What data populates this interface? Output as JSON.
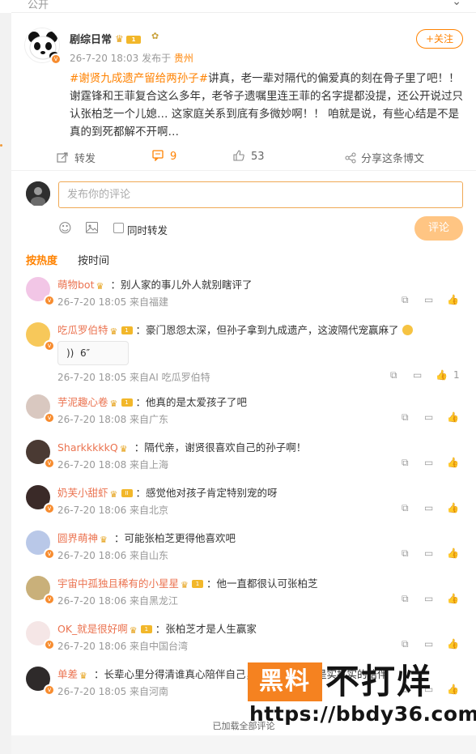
{
  "topbar": {
    "visibility_label": "公开"
  },
  "post": {
    "author": "剧综日常",
    "level": "1",
    "date": "26-7-20 18:03",
    "location_prefix": "发布于",
    "location": "贵州",
    "follow_label": "+关注",
    "hashtag": "#谢贤九成遗产留给两孙子#",
    "body": "讲真，老一辈对隔代的偏爱真的刻在骨子里了吧！！谢霆锋和王菲复合这么多年，老爷子遗嘱里连王菲的名字提都没提，还公开说过只认张柏芝一个儿媳… 这家庭关系到底有多微妙啊！！ 咱就是说，有些心结是不是真的到死都解不开啊…",
    "actions": {
      "repost_label": "转发",
      "comment_count": "9",
      "like_count": "53",
      "share_label": "分享这条博文"
    }
  },
  "composer": {
    "placeholder": "发布你的评论",
    "repost_checkbox_label": "同时转发",
    "submit_label": "评论"
  },
  "sort": {
    "hot_label": "按热度",
    "time_label": "按时间"
  },
  "comments": [
    {
      "name": "萌物bot",
      "level": "",
      "text": "别人家的事儿外人就别瞎评了",
      "time": "26-7-20 18:05 来自福建",
      "likes": "",
      "avatar_color": "#f2c6e6"
    },
    {
      "name": "吃瓜罗伯特",
      "level": "1",
      "text": "豪门恩怨太深，但孙子拿到九成遗产，这波隔代宠赢麻了",
      "time": "26-7-20 18:05 来自AI 吃瓜罗伯特",
      "likes": "1",
      "voice": "6″",
      "avatar_color": "#f7c85a"
    },
    {
      "name": "芋泥趣心卷",
      "level": "1",
      "text": "他真的是太爱孩子了吧",
      "time": "26-7-20 18:08 来自广东",
      "likes": "",
      "avatar_color": "#d9c8c0"
    },
    {
      "name": "SharkkkkkQ",
      "level": "",
      "text": "隔代亲，谢贤很喜欢自己的孙子啊！",
      "time": "26-7-20 18:08 来自上海",
      "likes": "",
      "avatar_color": "#4a3a33"
    },
    {
      "name": "奶芙小甜虾",
      "level": "II",
      "text": "感觉他对孩子肯定特别宠的呀",
      "time": "26-7-20 18:06 来自北京",
      "likes": "",
      "avatar_color": "#3a2a28"
    },
    {
      "name": "圆界萌神",
      "level": "",
      "text": "可能张柏芝更得他喜欢吧",
      "time": "26-7-20 18:06 来自山东",
      "likes": "",
      "avatar_color": "#b9c8e8"
    },
    {
      "name": "宇宙中孤独且稀有的小星星",
      "level": "1",
      "text": "他一直都很认可张柏芝",
      "time": "26-7-20 18:06 来自黑龙江",
      "likes": "",
      "avatar_color": "#c9b07a"
    },
    {
      "name": "OK_就是很好啊",
      "level": "1",
      "text": "张柏芝才是人生赢家",
      "time": "26-7-20 18:06 来自中国台湾",
      "likes": "",
      "avatar_color": "#f5e6e6"
    },
    {
      "name": "单差",
      "level": "",
      "text": "长辈心里分得清谁真心陪伴自己，他要的不是钱是实打实的陪伴",
      "time": "26-7-20 18:05 来自河南",
      "likes": "",
      "avatar_color": "#2e2a2a"
    }
  ],
  "footer": {
    "label": "已加载全部评论"
  },
  "watermark": {
    "box_text": "黑料",
    "big_text": "不打烊",
    "url": "https://bbdy36.com"
  }
}
